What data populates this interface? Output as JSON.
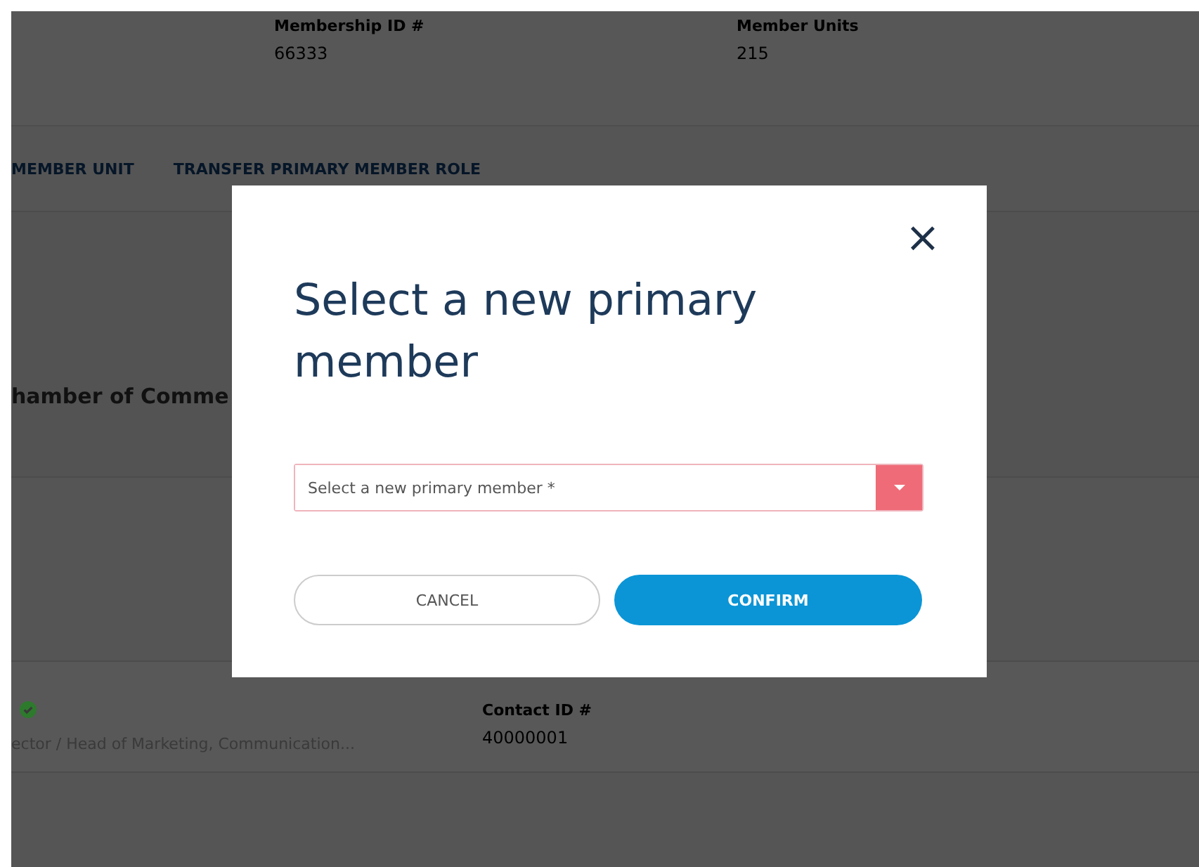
{
  "background": {
    "summary": [
      {
        "label": "Membership ID #",
        "value": "66333"
      },
      {
        "label": "Member Units",
        "value": "215"
      }
    ],
    "tabs": [
      {
        "label": "MEMBER UNIT",
        "selected": false
      },
      {
        "label": "TRANSFER PRIMARY MEMBER ROLE",
        "selected": false
      }
    ],
    "organization": "hamber of Comme",
    "contact": {
      "verified": true,
      "role": "ector / Head of Marketing, Communication...",
      "id_label": "Contact ID #",
      "id_value": "40000001"
    }
  },
  "dialog": {
    "title": "Select a new primary member",
    "close": "×",
    "select": {
      "placeholder": "Select a new primary member *",
      "invalid": true
    },
    "buttons": [
      {
        "label": "CANCEL",
        "kind": "outline"
      },
      {
        "label": "CONFIRM",
        "kind": "primary"
      }
    ]
  }
}
